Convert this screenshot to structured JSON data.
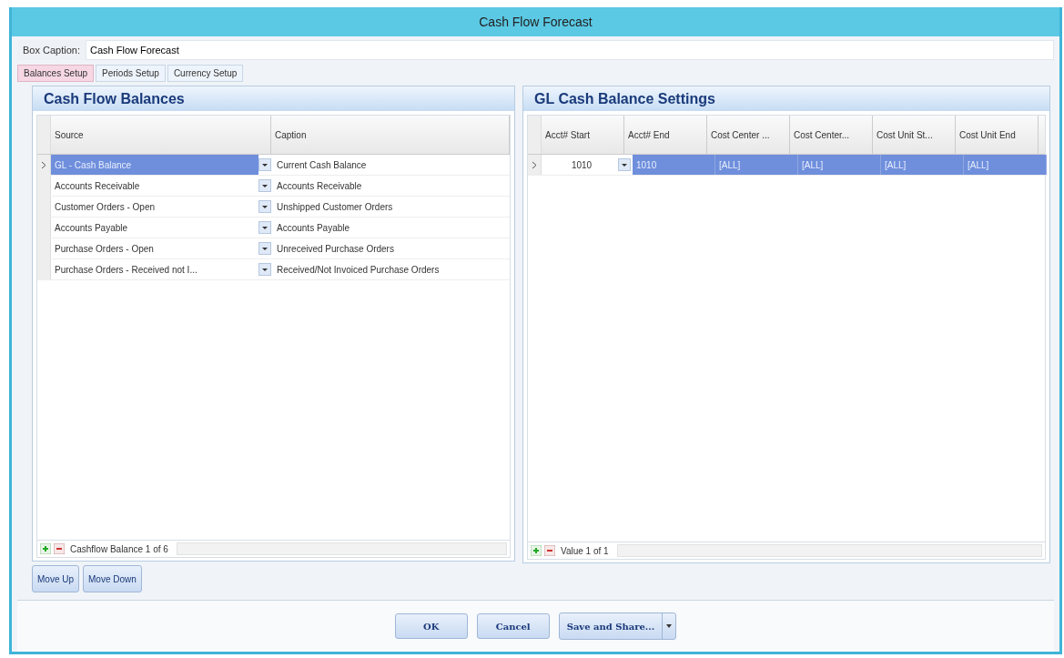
{
  "window": {
    "title": "Cash Flow Forecast"
  },
  "box_caption": {
    "label": "Box Caption:",
    "value": "Cash Flow Forecast"
  },
  "tabs": [
    {
      "label": "Balances Setup",
      "selected": true
    },
    {
      "label": "Periods Setup",
      "selected": false
    },
    {
      "label": "Currency Setup",
      "selected": false
    }
  ],
  "balances": {
    "title": "Cash Flow Balances",
    "columns": [
      "Source",
      "Caption"
    ],
    "rows": [
      {
        "source": "GL - Cash Balance",
        "caption": "Current Cash Balance",
        "selected": true
      },
      {
        "source": "Accounts Receivable",
        "caption": "Accounts Receivable",
        "selected": false
      },
      {
        "source": "Customer Orders - Open",
        "caption": "Unshipped Customer Orders",
        "selected": false
      },
      {
        "source": "Accounts Payable",
        "caption": "Accounts Payable",
        "selected": false
      },
      {
        "source": "Purchase Orders - Open",
        "caption": "Unreceived Purchase Orders",
        "selected": false
      },
      {
        "source": "Purchase Orders - Received not I...",
        "caption": "Received/Not Invoiced Purchase Orders",
        "selected": false
      }
    ],
    "navigator": "Cashflow Balance 1 of 6"
  },
  "settings": {
    "title": "GL Cash Balance Settings",
    "columns": [
      "Acct# Start",
      "Acct# End",
      "Cost Center ...",
      "Cost Center...",
      "Cost Unit St...",
      "Cost Unit End"
    ],
    "rows": [
      {
        "cells": [
          "1010",
          "1010",
          "[ALL]",
          "[ALL]",
          "[ALL]",
          "[ALL]"
        ],
        "selected": true
      }
    ],
    "navigator": "Value 1 of 1"
  },
  "move_buttons": [
    "Move Up",
    "Move Down"
  ],
  "buttons": [
    "OK",
    "Cancel",
    "Save and Share..."
  ]
}
